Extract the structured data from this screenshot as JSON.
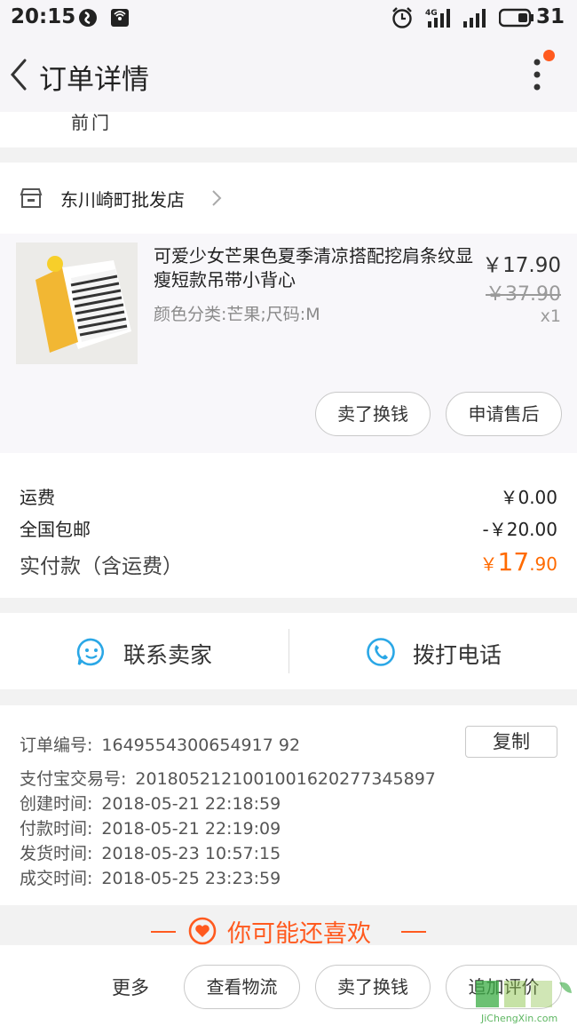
{
  "status_bar": {
    "time": "20:15",
    "battery_level": "31",
    "network_badge": "4G"
  },
  "header": {
    "title": "订单详情"
  },
  "address": {
    "tail_text": "前门"
  },
  "shop": {
    "name": "东川崎町批发店"
  },
  "product": {
    "title": "可爱少女芒果色夏季清凉搭配挖肩条纹显瘦短款吊带小背心",
    "sku": "颜色分类:芒果;尺码:M",
    "price": "￥17.90",
    "original_price": "￥37.90",
    "quantity": "x1",
    "actions": [
      "卖了换钱",
      "申请售后"
    ]
  },
  "fees": {
    "shipping_label": "运费",
    "shipping_value": "￥0.00",
    "free_shipping_label": "全国包邮",
    "free_shipping_value": "-￥20.00",
    "paid_label": "实付款（含运费）",
    "paid_currency": "￥",
    "paid_integer": "17",
    "paid_decimal": ".90"
  },
  "contact": {
    "seller_label": "联系卖家",
    "phone_label": "拨打电话"
  },
  "order_info": {
    "order_no_label": "订单编号:",
    "order_no": "1649554300654917 92",
    "copy_label": "复制",
    "alipay_label": "支付宝交易号:",
    "alipay_no": "2018052121001001620277345897",
    "created_label": "创建时间:",
    "created": "2018-05-21 22:18:59",
    "paid_label": "付款时间:",
    "paid": "2018-05-21 22:19:09",
    "shipped_label": "发货时间:",
    "shipped": "2018-05-23 10:57:15",
    "completed_label": "成交时间:",
    "completed": "2018-05-25 23:23:59"
  },
  "recommend": {
    "title": "你可能还喜欢"
  },
  "bottom_bar": {
    "more_label": "更多",
    "buttons": [
      "查看物流",
      "卖了换钱",
      "追加评价"
    ]
  },
  "watermark": {
    "text": "JiChengXin.com"
  },
  "colors": {
    "accent": "#ff6a00",
    "icon_blue": "#2aa7e6",
    "notify_dot": "#ff5a1f"
  }
}
